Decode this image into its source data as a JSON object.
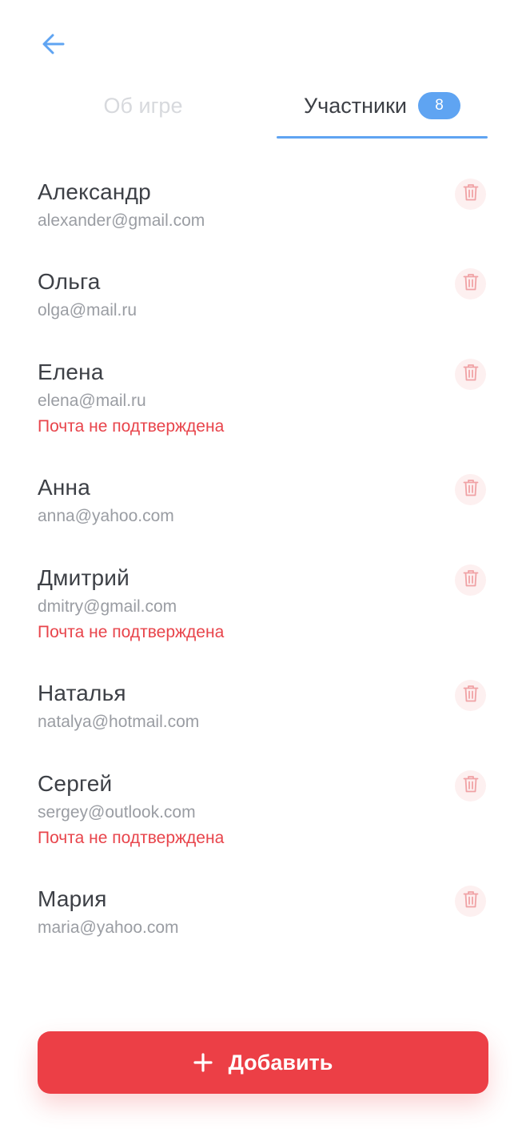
{
  "header": {
    "back_icon": "arrow-left-icon"
  },
  "tabs": {
    "about_label": "Об игре",
    "participants_label": "Участники",
    "participants_count": "8"
  },
  "colors": {
    "accent": "#5fa4f2",
    "danger": "#ec3f46",
    "text": "#3d4046",
    "muted": "#9a9da3"
  },
  "participants": [
    {
      "name": "Александр",
      "email": "alexander@gmail.com",
      "warning": ""
    },
    {
      "name": "Ольга",
      "email": "olga@mail.ru",
      "warning": ""
    },
    {
      "name": "Елена",
      "email": "elena@mail.ru",
      "warning": "Почта не подтверждена"
    },
    {
      "name": "Анна",
      "email": "anna@yahoo.com",
      "warning": ""
    },
    {
      "name": "Дмитрий",
      "email": "dmitry@gmail.com",
      "warning": "Почта не подтверждена"
    },
    {
      "name": "Наталья",
      "email": "natalya@hotmail.com",
      "warning": ""
    },
    {
      "name": "Сергей",
      "email": "sergey@outlook.com",
      "warning": "Почта не подтверждена"
    },
    {
      "name": "Мария",
      "email": "maria@yahoo.com",
      "warning": ""
    }
  ],
  "add_button": {
    "label": "Добавить",
    "icon": "plus-icon"
  }
}
